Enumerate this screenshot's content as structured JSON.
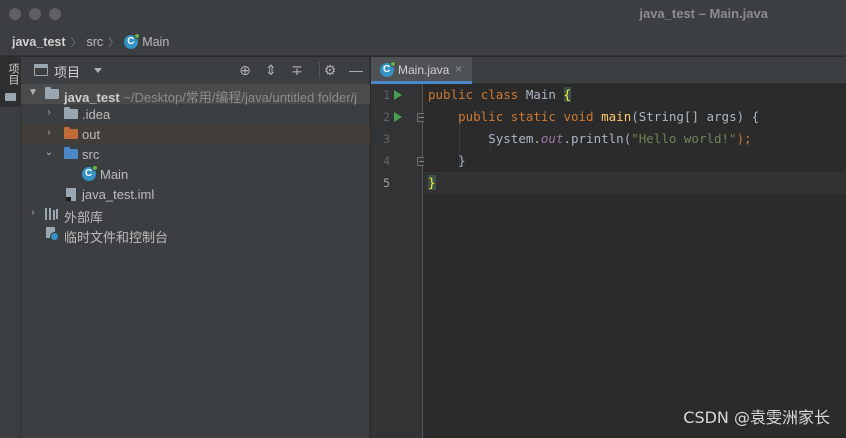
{
  "window": {
    "title": "java_test – Main.java"
  },
  "breadcrumb": {
    "project": "java_test",
    "folder": "src",
    "file": "Main"
  },
  "stripe": {
    "tab_label": "项目"
  },
  "project_panel": {
    "title": "项目",
    "tree": [
      {
        "label": "java_test",
        "path": "~/Desktop/常用/编程/java/untitled folder/j"
      },
      {
        "label": ".idea"
      },
      {
        "label": "out"
      },
      {
        "label": "src"
      },
      {
        "label": "Main"
      },
      {
        "label": "java_test.iml"
      },
      {
        "label": "外部库"
      },
      {
        "label": "临时文件和控制台"
      }
    ]
  },
  "editor": {
    "tab_label": "Main.java",
    "tab_close": "×",
    "line_numbers": [
      "1",
      "2",
      "3",
      "4",
      "5"
    ],
    "code": {
      "l1_kw1": "public",
      "l1_kw2": "class",
      "l1_name": "Main",
      "l1_brace": "{",
      "l2_kw1": "public",
      "l2_kw2": "static",
      "l2_kw3": "void",
      "l2_fn": "main",
      "l2_params": "(String[] args) {",
      "l3_obj": "System.",
      "l3_field": "out",
      "l3_call": ".println(",
      "l3_str": "\"Hello world!\"",
      "l3_end": ");",
      "l4": "}",
      "l5": "}"
    }
  },
  "watermark": "CSDN @袁雯洲家长",
  "colors": {
    "keyword": "#cc7832",
    "function": "#ffc66d",
    "string": "#6a8759",
    "field": "#9876aa",
    "accent": "#4a88c7",
    "run": "#499c54"
  }
}
